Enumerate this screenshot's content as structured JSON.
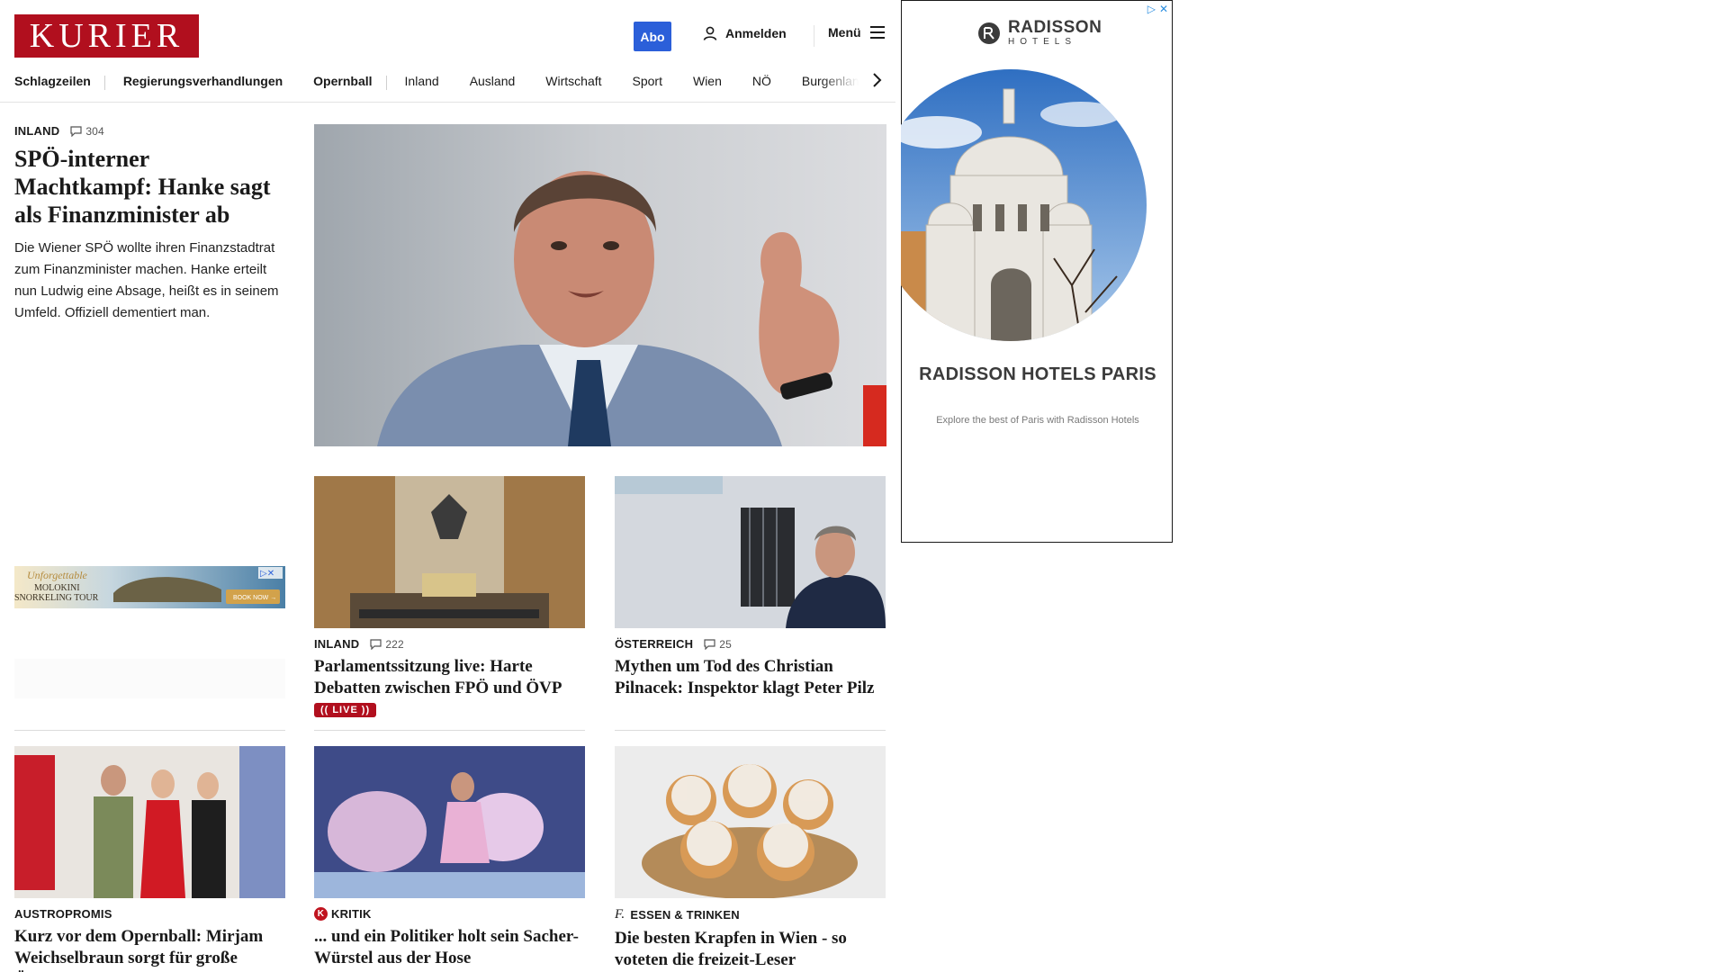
{
  "brand": {
    "logo_text": "KURIER",
    "color": "#b10f1e"
  },
  "header": {
    "abo_label": "Abo",
    "login_label": "Anmelden",
    "menu_label": "Menü"
  },
  "nav": {
    "items": [
      {
        "label": "Schlagzeilen",
        "bold": true
      },
      {
        "label": "Regierungsverhandlungen",
        "bold": true
      },
      {
        "label": "Opernball",
        "bold": true
      },
      {
        "label": "Inland",
        "bold": false
      },
      {
        "label": "Ausland",
        "bold": false
      },
      {
        "label": "Wirtschaft",
        "bold": false
      },
      {
        "label": "Sport",
        "bold": false
      },
      {
        "label": "Wien",
        "bold": false
      },
      {
        "label": "NÖ",
        "bold": false
      },
      {
        "label": "Burgenland",
        "bold": false
      }
    ]
  },
  "lead": {
    "category": "INLAND",
    "comments": "304",
    "title": "SPÖ-interner Machtkampf: Hanke sagt als Finanzminister ab",
    "description": "Die Wiener SPÖ wollte ihren Finanzstadtrat zum Finanzminister machen. Hanke erteilt nun Ludwig eine Absage, heißt es in seinem Umfeld. Offiziell dementiert man."
  },
  "left_ad": {
    "script_text": "Unforgettable",
    "line1": "MOLOKINI",
    "line2": "SNORKELING TOUR",
    "cta": "BOOK NOW →"
  },
  "cards_row1": [
    {
      "category": "INLAND",
      "comments": "222",
      "title": "Parlamentssitzung live: Harte Debatten zwischen FPÖ und ÖVP",
      "live": "LIVE"
    },
    {
      "category": "ÖSTERREICH",
      "comments": "25",
      "title": "Mythen um Tod des Christian Pilnacek: Inspektor klagt Peter Pilz"
    }
  ],
  "cards_row2": [
    {
      "category": "AUSTROPROMIS",
      "title": "Kurz vor dem Opernball: Mirjam Weichselbraun sorgt für große Überraschung"
    },
    {
      "category": "KRITIK",
      "title": "... und ein Politiker holt sein Sacher-Würstel aus der Hose"
    },
    {
      "category": "ESSEN & TRINKEN",
      "title": "Die besten Krapfen in Wien - so voteten die freizeit-Leser"
    }
  ],
  "right_ad": {
    "brand_name": "RADISSON",
    "brand_sub": "HOTELS",
    "headline": "RADISSON HOTELS PARIS",
    "tagline": "Explore the best of Paris with Radisson Hotels"
  }
}
